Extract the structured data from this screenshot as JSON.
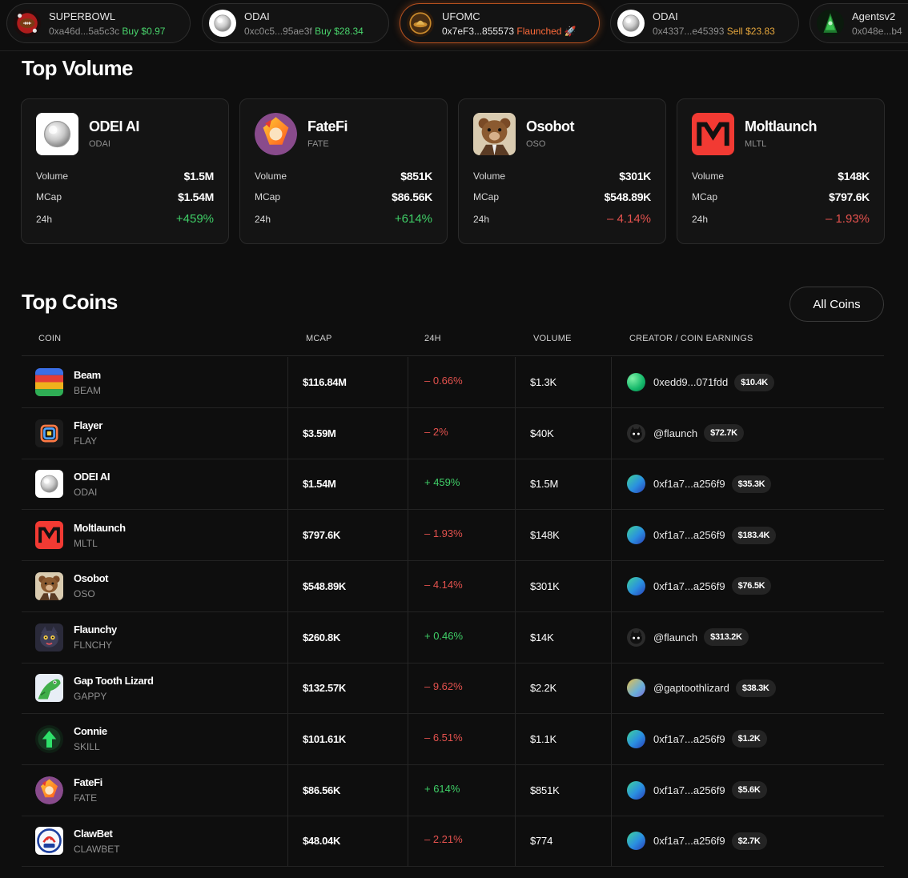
{
  "ticker": [
    {
      "name": "SUPERBOWL",
      "address": "0xa46d...5a5c3c",
      "action": "Buy $0.97",
      "action_type": "buy",
      "icon": "superbowl-avatar"
    },
    {
      "name": "ODAI",
      "address": "0xc0c5...95ae3f",
      "action": "Buy $28.34",
      "action_type": "buy",
      "icon": "odai-avatar"
    },
    {
      "name": "UFOMC",
      "address": "0x7eF3...855573",
      "action": "Flaunched 🚀",
      "action_type": "launch",
      "icon": "ufomc-avatar"
    },
    {
      "name": "ODAI",
      "address": "0x4337...e45393",
      "action": "Sell $23.83",
      "action_type": "sell",
      "icon": "odai-avatar"
    },
    {
      "name": "Agentsv2",
      "address": "0x048e...b4",
      "action": "",
      "action_type": "",
      "icon": "agentsv2-avatar"
    }
  ],
  "top_volume": {
    "title": "Top Volume",
    "labels": {
      "volume": "Volume",
      "mcap": "MCap",
      "change": "24h"
    },
    "cards": [
      {
        "name": "ODEI AI",
        "ticker": "ODAI",
        "volume": "$1.5M",
        "mcap": "$1.54M",
        "change": "+459%",
        "direction": "up"
      },
      {
        "name": "FateFi",
        "ticker": "FATE",
        "volume": "$851K",
        "mcap": "$86.56K",
        "change": "+614%",
        "direction": "up"
      },
      {
        "name": "Osobot",
        "ticker": "OSO",
        "volume": "$301K",
        "mcap": "$548.89K",
        "change": "– 4.14%",
        "direction": "down"
      },
      {
        "name": "Moltlaunch",
        "ticker": "MLTL",
        "volume": "$148K",
        "mcap": "$797.6K",
        "change": "– 1.93%",
        "direction": "down"
      }
    ]
  },
  "top_coins": {
    "title": "Top Coins",
    "all_coins_label": "All Coins",
    "columns": [
      "COIN",
      "MCAP",
      "24H",
      "VOLUME",
      "CREATOR / COIN EARNINGS"
    ],
    "rows": [
      {
        "name": "Beam",
        "ticker": "BEAM",
        "mcap": "$116.84M",
        "change": "– 0.66%",
        "direction": "down",
        "volume": "$1.3K",
        "creator": "0xedd9...071fdd",
        "earnings": "$10.4K",
        "logo": "beam-logo",
        "creator_avatar": "green"
      },
      {
        "name": "Flayer",
        "ticker": "FLAY",
        "mcap": "$3.59M",
        "change": "– 2%",
        "direction": "down",
        "volume": "$40K",
        "creator": "@flaunch",
        "earnings": "$72.7K",
        "logo": "flayer-logo",
        "creator_avatar": "flaunch"
      },
      {
        "name": "ODEI AI",
        "ticker": "ODAI",
        "mcap": "$1.54M",
        "change": "+ 459%",
        "direction": "up",
        "volume": "$1.5M",
        "creator": "0xf1a7...a256f9",
        "earnings": "$35.3K",
        "logo": "odai-logo",
        "creator_avatar": "blue"
      },
      {
        "name": "Moltlaunch",
        "ticker": "MLTL",
        "mcap": "$797.6K",
        "change": "– 1.93%",
        "direction": "down",
        "volume": "$148K",
        "creator": "0xf1a7...a256f9",
        "earnings": "$183.4K",
        "logo": "moltlaunch-logo",
        "creator_avatar": "blue"
      },
      {
        "name": "Osobot",
        "ticker": "OSO",
        "mcap": "$548.89K",
        "change": "– 4.14%",
        "direction": "down",
        "volume": "$301K",
        "creator": "0xf1a7...a256f9",
        "earnings": "$76.5K",
        "logo": "osobot-logo",
        "creator_avatar": "blue"
      },
      {
        "name": "Flaunchy",
        "ticker": "FLNCHY",
        "mcap": "$260.8K",
        "change": "+ 0.46%",
        "direction": "up",
        "volume": "$14K",
        "creator": "@flaunch",
        "earnings": "$313.2K",
        "logo": "flaunchy-logo",
        "creator_avatar": "flaunch"
      },
      {
        "name": "Gap Tooth Lizard",
        "ticker": "GAPPY",
        "mcap": "$132.57K",
        "change": "– 9.62%",
        "direction": "down",
        "volume": "$2.2K",
        "creator": "@gaptoothlizard",
        "earnings": "$38.3K",
        "logo": "gappy-logo",
        "creator_avatar": "gap"
      },
      {
        "name": "Connie",
        "ticker": "SKILL",
        "mcap": "$101.61K",
        "change": "– 6.51%",
        "direction": "down",
        "volume": "$1.1K",
        "creator": "0xf1a7...a256f9",
        "earnings": "$1.2K",
        "logo": "connie-logo",
        "creator_avatar": "blue"
      },
      {
        "name": "FateFi",
        "ticker": "FATE",
        "mcap": "$86.56K",
        "change": "+ 614%",
        "direction": "up",
        "volume": "$851K",
        "creator": "0xf1a7...a256f9",
        "earnings": "$5.6K",
        "logo": "fatefi-logo",
        "creator_avatar": "blue"
      },
      {
        "name": "ClawBet",
        "ticker": "CLAWBET",
        "mcap": "$48.04K",
        "change": "– 2.21%",
        "direction": "down",
        "volume": "$774",
        "creator": "0xf1a7...a256f9",
        "earnings": "$2.7K",
        "logo": "clawbet-logo",
        "creator_avatar": "blue"
      }
    ]
  },
  "colors": {
    "positive": "#3fcf67",
    "negative": "#e4524e",
    "buy": "#49d46c",
    "sell": "#e5a63c",
    "launch": "#ff6a3a",
    "background": "#0e0e0e"
  }
}
